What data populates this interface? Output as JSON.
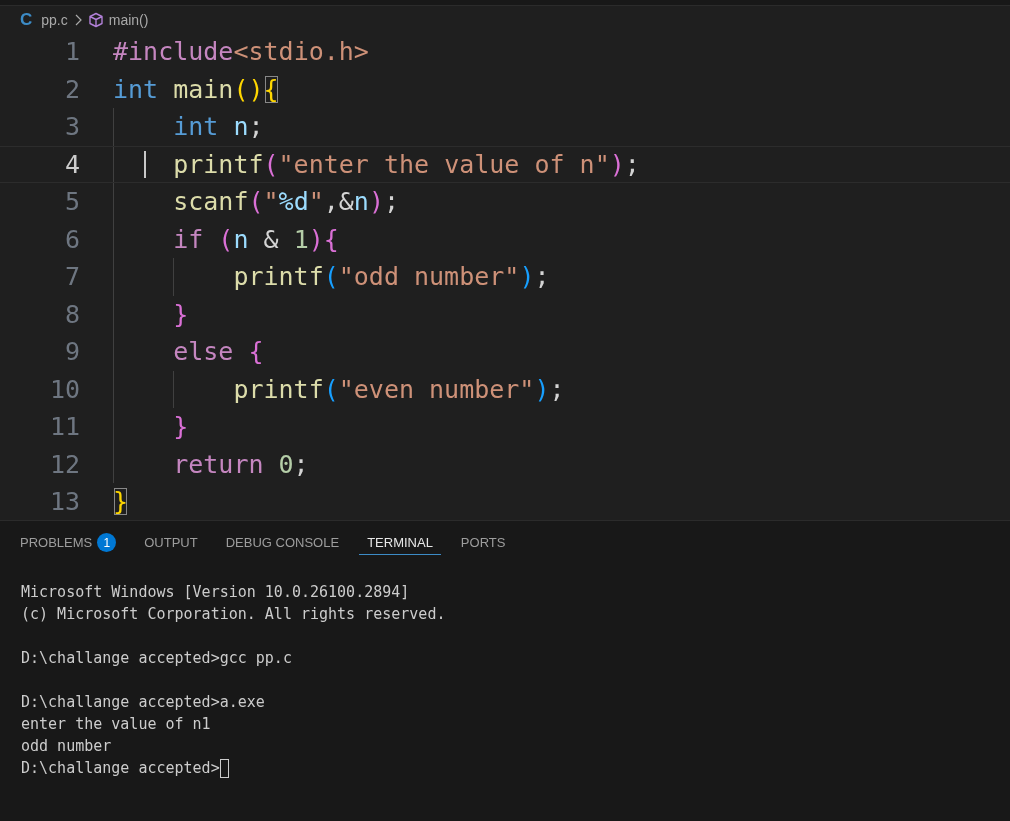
{
  "breadcrumb": {
    "file_icon": "C",
    "file": "pp.c",
    "symbol": "main()"
  },
  "editor": {
    "lines": [
      {
        "number": "1",
        "current": false,
        "tokens": [
          {
            "kind": "directive",
            "text": "#include"
          },
          {
            "kind": "header",
            "text": "<stdio.h>"
          }
        ]
      },
      {
        "number": "2",
        "current": false,
        "tokens": [
          {
            "kind": "keyword",
            "text": "int "
          },
          {
            "kind": "function",
            "text": "main"
          },
          {
            "kind": "bracket1",
            "text": "()"
          },
          {
            "kind": "bracket1",
            "text": "{",
            "matched": true
          }
        ],
        "children": [
          {
            "number": "3",
            "current": false,
            "tokens": [
              {
                "kind": "keyword",
                "text": "int "
              },
              {
                "kind": "variable",
                "text": "n"
              },
              {
                "kind": "punct",
                "text": ";"
              }
            ]
          },
          {
            "number": "4",
            "current": true,
            "tokens": [
              {
                "kind": "function",
                "text": "printf"
              },
              {
                "kind": "bracket2",
                "text": "("
              },
              {
                "kind": "string",
                "text": "\"enter the value of n\""
              },
              {
                "kind": "bracket2",
                "text": ")"
              },
              {
                "kind": "punct",
                "text": ";"
              }
            ]
          },
          {
            "number": "5",
            "current": false,
            "tokens": [
              {
                "kind": "function",
                "text": "scanf"
              },
              {
                "kind": "bracket2",
                "text": "("
              },
              {
                "kind": "string",
                "text": "\""
              },
              {
                "kind": "format",
                "text": "%d"
              },
              {
                "kind": "string",
                "text": "\""
              },
              {
                "kind": "punct",
                "text": ",&"
              },
              {
                "kind": "variable",
                "text": "n"
              },
              {
                "kind": "bracket2",
                "text": ")"
              },
              {
                "kind": "punct",
                "text": ";"
              }
            ]
          },
          {
            "number": "6",
            "current": false,
            "tokens": [
              {
                "kind": "control",
                "text": "if "
              },
              {
                "kind": "bracket2",
                "text": "("
              },
              {
                "kind": "variable",
                "text": "n"
              },
              {
                "kind": "punct",
                "text": " & "
              },
              {
                "kind": "number",
                "text": "1"
              },
              {
                "kind": "bracket2",
                "text": ")"
              },
              {
                "kind": "bracket2",
                "text": "{"
              }
            ],
            "children": [
              {
                "number": "7",
                "current": false,
                "tokens": [
                  {
                    "kind": "function",
                    "text": "printf"
                  },
                  {
                    "kind": "bracket3",
                    "text": "("
                  },
                  {
                    "kind": "string",
                    "text": "\"odd number\""
                  },
                  {
                    "kind": "bracket3",
                    "text": ")"
                  },
                  {
                    "kind": "punct",
                    "text": ";"
                  }
                ]
              }
            ]
          },
          {
            "number": "8",
            "current": false,
            "tokens": [
              {
                "kind": "bracket2",
                "text": "}"
              }
            ]
          },
          {
            "number": "9",
            "current": false,
            "tokens": [
              {
                "kind": "control",
                "text": "else "
              },
              {
                "kind": "bracket2",
                "text": "{"
              }
            ],
            "children": [
              {
                "number": "10",
                "current": false,
                "tokens": [
                  {
                    "kind": "function",
                    "text": "printf"
                  },
                  {
                    "kind": "bracket3",
                    "text": "("
                  },
                  {
                    "kind": "string",
                    "text": "\"even number\""
                  },
                  {
                    "kind": "bracket3",
                    "text": ")"
                  },
                  {
                    "kind": "punct",
                    "text": ";"
                  }
                ]
              }
            ]
          },
          {
            "number": "11",
            "current": false,
            "tokens": [
              {
                "kind": "bracket2",
                "text": "}"
              }
            ]
          },
          {
            "number": "12",
            "current": false,
            "tokens": [
              {
                "kind": "control",
                "text": "return "
              },
              {
                "kind": "number",
                "text": "0"
              },
              {
                "kind": "punct",
                "text": ";"
              }
            ]
          }
        ]
      },
      {
        "number": "13",
        "current": false,
        "tokens": [
          {
            "kind": "bracket1",
            "text": "}",
            "matched": true
          }
        ]
      }
    ]
  },
  "panel": {
    "tabs": [
      {
        "label": "PROBLEMS",
        "badge": "1",
        "selected": false
      },
      {
        "label": "OUTPUT",
        "selected": false
      },
      {
        "label": "DEBUG CONSOLE",
        "selected": false
      },
      {
        "label": "TERMINAL",
        "selected": true
      },
      {
        "label": "PORTS",
        "selected": false
      }
    ],
    "terminal": {
      "blocks": [
        [
          "Microsoft Windows [Version 10.0.26100.2894]",
          "(c) Microsoft Corporation. All rights reserved."
        ],
        [
          "D:\\challange accepted>gcc pp.c"
        ],
        [
          "D:\\challange accepted>a.exe",
          "enter the value of n1",
          "odd number",
          "D:\\challange accepted>"
        ]
      ],
      "cursor": true
    }
  }
}
